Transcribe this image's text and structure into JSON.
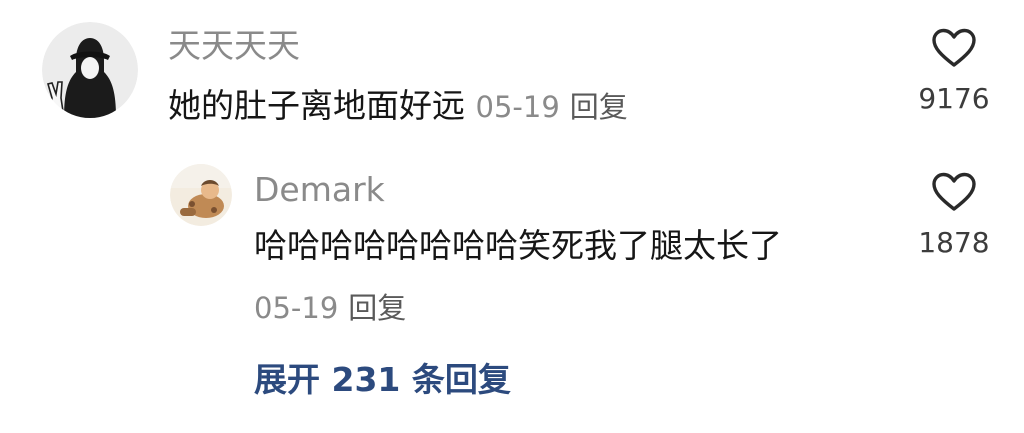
{
  "comment": {
    "username": "天天天天",
    "text": "她的肚子离地面好远",
    "date": "05-19",
    "reply_label": "回复",
    "like_count": "9176"
  },
  "sub_reply": {
    "username": "Demark",
    "text": "哈哈哈哈哈哈哈哈笑死我了腿太长了",
    "date": "05-19",
    "reply_label": "回复",
    "like_count": "1878"
  },
  "expand_label": "展开 231 条回复",
  "icons": {
    "like": "heart-outline-icon"
  },
  "colors": {
    "background": "#ffffff",
    "username": "#8a8a8a",
    "text": "#161616",
    "meta": "#8a8a8a",
    "expand_link": "#2c4a7e"
  }
}
